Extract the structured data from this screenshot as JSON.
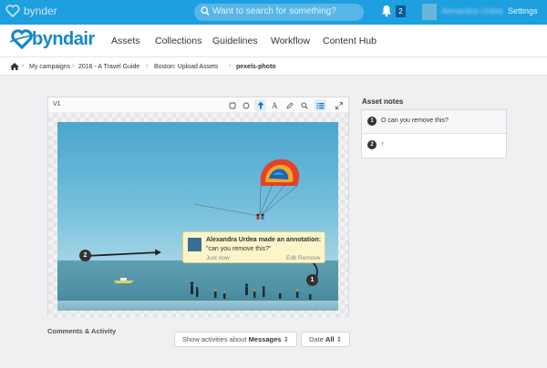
{
  "topbar": {
    "logo_text": "bynder",
    "search_placeholder": "Want to search for something?",
    "notification_count": "2",
    "user_name": "Alexandra Urdea",
    "settings_label": "Settings",
    "bg_color": "#1e9fe0"
  },
  "nav": {
    "brand": "byndair",
    "items": [
      "Assets",
      "Collections",
      "Guidelines",
      "Workflow",
      "Content Hub"
    ]
  },
  "breadcrumb": {
    "items": [
      "My campaigns",
      "2016 - A Travel Guide",
      "Boston: Upload Assets"
    ],
    "current": "pexels-photo"
  },
  "viewer": {
    "version": "V1",
    "tools": [
      "rectangle-icon",
      "circle-icon",
      "arrow-icon",
      "text-icon",
      "pen-icon",
      "zoom-icon",
      "list-icon",
      "fullscreen-icon"
    ],
    "pins": [
      "1",
      "2"
    ],
    "annotation": {
      "author_line": "Alexandra Urdea made an annotation:",
      "text": "\"can you remove this?\"",
      "time": "Just now",
      "actions": "Edit Remove"
    }
  },
  "asset_notes": {
    "title": "Asset notes",
    "items": [
      {
        "num": "1",
        "text": "O can you remove this?"
      },
      {
        "num": "2",
        "text": "↑"
      }
    ]
  },
  "comments": {
    "title": "Comments & Activity",
    "filter_prefix": "Show activities about",
    "filter_value": "Messages",
    "sort_prefix": "Date",
    "sort_value": "All"
  }
}
